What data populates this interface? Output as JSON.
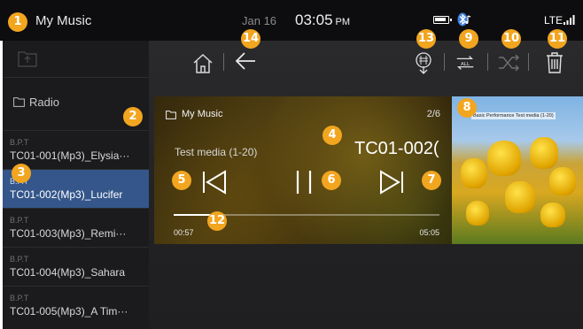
{
  "status": {
    "app_title": "My Music",
    "date": "Jan 16",
    "time": "03:05",
    "ampm": "PM",
    "network": "LTE"
  },
  "sidebar": {
    "radio_label": "Radio",
    "items": [
      {
        "artist": "B.P.T",
        "title": "TC01-001(Mp3)_Elysia···",
        "active": false
      },
      {
        "artist": "B.P.T",
        "title": "TC01-002(Mp3)_Lucifer",
        "active": true
      },
      {
        "artist": "B.P.T",
        "title": "TC01-003(Mp3)_Remi···",
        "active": false
      },
      {
        "artist": "B.P.T",
        "title": "TC01-004(Mp3)_Sahara",
        "active": false
      },
      {
        "artist": "B.P.T",
        "title": "TC01-005(Mp3)_A Tim···",
        "active": false
      }
    ]
  },
  "player": {
    "folder": "My Music",
    "index": "2/6",
    "media_name": "Test media (1-20)",
    "track_title": "TC01-002(",
    "elapsed": "00:57",
    "total": "05:05",
    "progress": 0.187,
    "album_caption": "Basic Performance Test media (1-20)"
  },
  "toolbar": {
    "repeat_label": "ALL"
  },
  "badges": [
    "1",
    "2",
    "3",
    "4",
    "5",
    "6",
    "7",
    "8",
    "9",
    "10",
    "11",
    "12",
    "13",
    "14"
  ],
  "colors": {
    "accent_badge": "#f2a51f",
    "active_row": "#34568a"
  }
}
